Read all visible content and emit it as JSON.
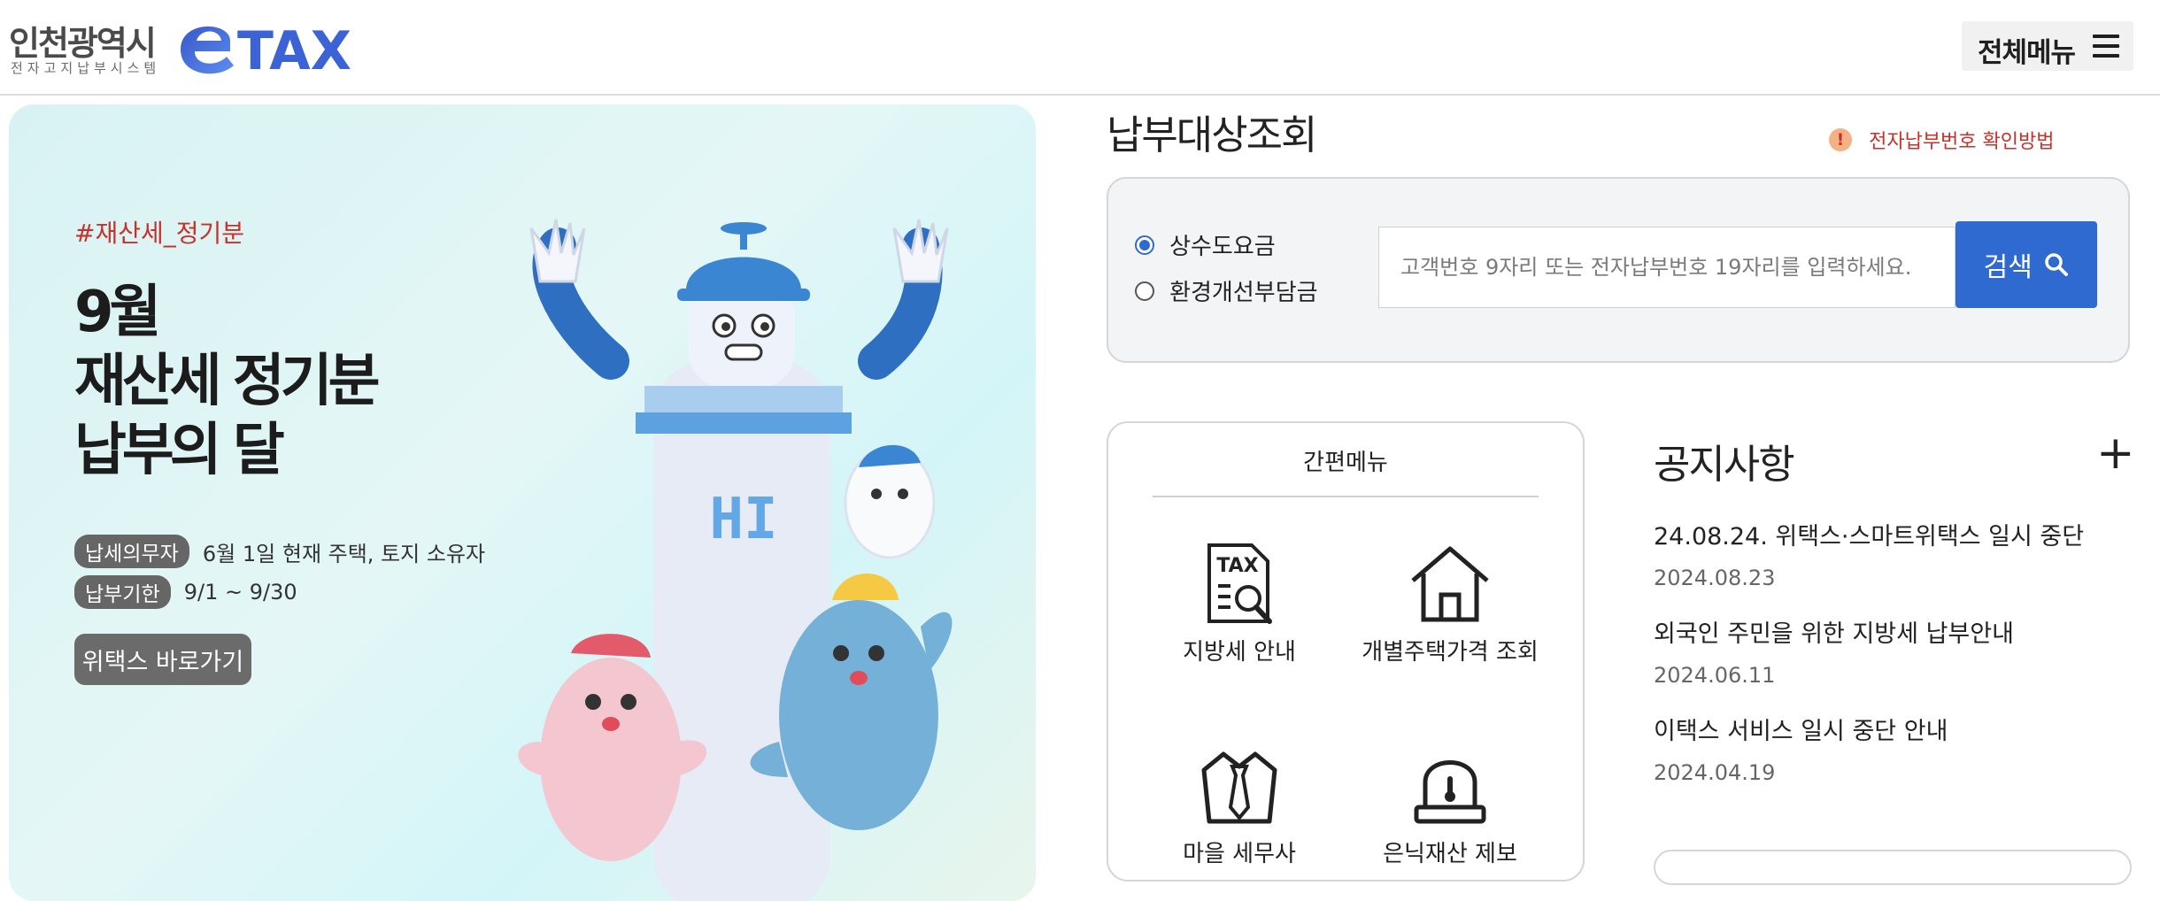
{
  "header": {
    "logo_city": "인천광역시",
    "logo_sub": "전자고지납부시스템",
    "logo_brand": "TAX",
    "menu_label": "전체메뉴"
  },
  "banner": {
    "tag": "#재산세_정기분",
    "headline": [
      "9월",
      "재산세 정기분",
      "납부의 달"
    ],
    "info": [
      {
        "pill": "납세의무자",
        "text": "6월 1일 현재 주택, 토지 소유자"
      },
      {
        "pill": "납부기한",
        "text": "9/1 ~ 9/30"
      }
    ],
    "button": "위택스 바로가기",
    "robot_text": "HI"
  },
  "lookup": {
    "title": "납부대상조회",
    "help_link": "전자납부번호 확인방법",
    "options": [
      {
        "label": "상수도요금",
        "checked": true
      },
      {
        "label": "환경개선부담금",
        "checked": false
      }
    ],
    "placeholder": "고객번호 9자리 또는 전자납부번호 19자리를 입력하세요.",
    "search_label": "검색"
  },
  "quick_menu": {
    "title": "간편메뉴",
    "items": [
      {
        "label": "지방세 안내",
        "icon": "tax-doc-icon"
      },
      {
        "label": "개별주택가격 조회",
        "icon": "house-icon"
      },
      {
        "label": "마을 세무사",
        "icon": "tie-icon"
      },
      {
        "label": "은닉재산 제보",
        "icon": "siren-icon"
      }
    ]
  },
  "notices": {
    "title": "공지사항",
    "items": [
      {
        "title": "24.08.24. 위택스·스마트위택스 일시 중단",
        "date": "2024.08.23"
      },
      {
        "title": "외국인 주민을 위한 지방세 납부안내",
        "date": "2024.06.11"
      },
      {
        "title": "이택스 서비스 일시 중단 안내",
        "date": "2024.04.19"
      }
    ]
  },
  "colors": {
    "brand_blue": "#2f6ad1",
    "accent_red": "#c7322a",
    "pill_gray": "#666666"
  }
}
